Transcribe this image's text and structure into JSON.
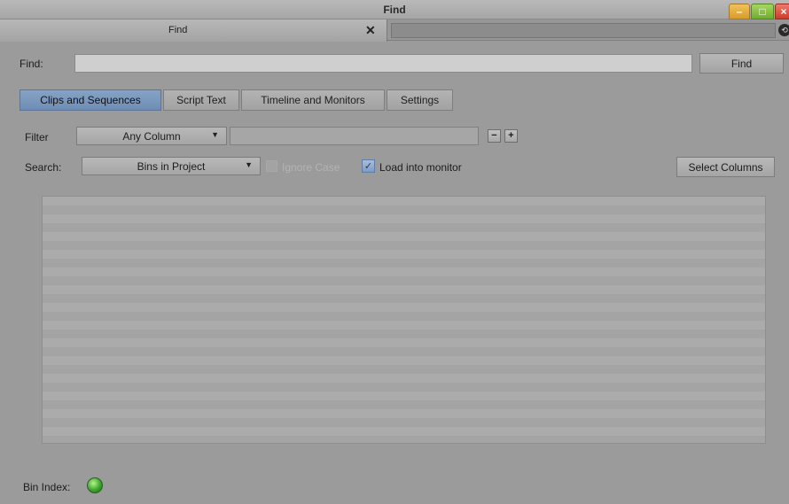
{
  "window": {
    "title": "Find"
  },
  "tab_strip": {
    "active_tab": "Find",
    "close_glyph": "✕"
  },
  "find_row": {
    "label": "Find:",
    "value": "",
    "button_label": "Find"
  },
  "content_tabs": [
    {
      "label": "Clips and Sequences",
      "selected": true
    },
    {
      "label": "Script Text",
      "selected": false
    },
    {
      "label": "Timeline and Monitors",
      "selected": false
    },
    {
      "label": "Settings",
      "selected": false
    }
  ],
  "filter_row": {
    "label": "Filter",
    "column_selected": "Any Column",
    "text_value": "",
    "minus_label": "−",
    "plus_label": "+"
  },
  "search_row": {
    "label": "Search:",
    "scope_selected": "Bins in Project",
    "ignore_case": {
      "label": "Ignore Case",
      "checked": false,
      "enabled": false
    },
    "load_into_monitor": {
      "label": "Load into monitor",
      "checked": true
    },
    "select_columns_label": "Select Columns"
  },
  "status": {
    "bin_index_label": "Bin Index:"
  },
  "colors": {
    "background": "#9b9b9b",
    "selected_tab": "#7a97bd",
    "bin_index_led": "#3aa52c"
  },
  "icons": {
    "minimize": "minimize-icon",
    "maximize": "maximize-icon",
    "close": "close-icon",
    "tab_menu": "tab-menu-icon",
    "dropdown": "chevron-down-icon",
    "checkmark": "checkmark-icon",
    "led": "status-led-icon"
  }
}
